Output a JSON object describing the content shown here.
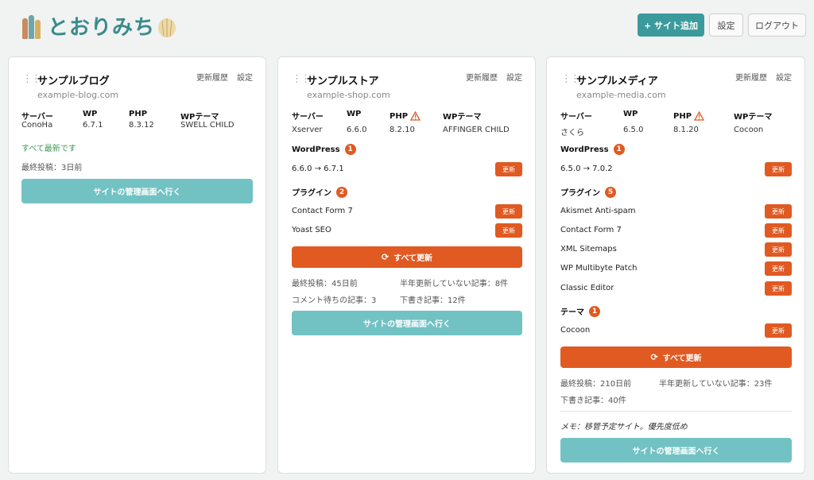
{
  "header": {
    "logo_text": "とおりみち",
    "add_site_label": "+ サイト追加",
    "settings_label": "設定",
    "logout_label": "ログアウト"
  },
  "common": {
    "history_label": "更新履歴",
    "settings_label": "設定",
    "server_label": "サーバー",
    "wp_label": "WP",
    "php_label": "PHP",
    "theme_label": "WPテーマ",
    "update_label": "更新",
    "update_all_label": "すべて更新",
    "admin_label": "サイトの管理画面へ行く",
    "wordpress_label": "WordPress",
    "plugins_label": "プラグイン",
    "themes_label": "テーマ"
  },
  "sites": [
    {
      "name": "サンプルブログ",
      "domain": "example-blog.com",
      "server": "ConoHa",
      "wp": "6.7.1",
      "php": "8.3.12",
      "theme": "SWELL CHILD",
      "status": "すべて最新です",
      "last_post": "最終投稿：3日前"
    },
    {
      "name": "サンプルストア",
      "domain": "example-shop.com",
      "server": "Xserver",
      "wp": "6.6.0",
      "php": "8.2.10",
      "theme": "AFFINGER CHILD",
      "wp_update_count": "1",
      "wp_update": "6.6.0 → 6.7.1",
      "plugin_count": "2",
      "plugins": [
        "Contact Form 7",
        "Yoast SEO"
      ],
      "last_post": "最終投稿：45日前",
      "stale_posts": "半年更新していない記事：8件",
      "pending_comments": "コメント待ちの記事：3",
      "drafts": "下書き記事：12件"
    },
    {
      "name": "サンプルメディア",
      "domain": "example-media.com",
      "server": "さくら",
      "wp": "6.5.0",
      "php": "8.1.20",
      "theme": "Cocoon",
      "wp_update_count": "1",
      "wp_update": "6.5.0 → 7.0.2",
      "plugin_count": "5",
      "plugins": [
        "Akismet Anti-spam",
        "Contact Form 7",
        "XML Sitemaps",
        "WP Multibyte Patch",
        "Classic Editor"
      ],
      "theme_count": "1",
      "theme_update": "Cocoon",
      "last_post": "最終投稿：210日前",
      "stale_posts": "半年更新していない記事：23件",
      "drafts": "下書き記事：40件",
      "memo": "メモ：移管予定サイト。優先度低め"
    }
  ],
  "colors": {
    "accent_teal": "#3b9a9c",
    "button_teal": "#72c2c4",
    "update_orange": "#e05a22",
    "ok_green": "#3c9a54"
  }
}
